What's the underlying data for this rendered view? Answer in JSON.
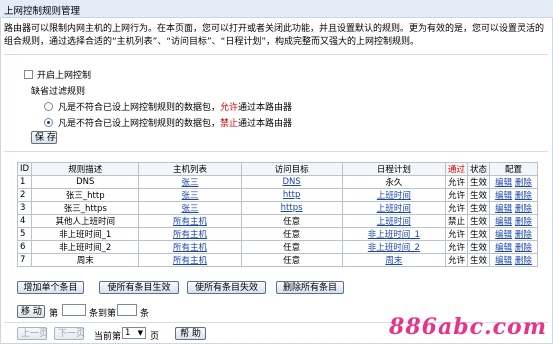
{
  "page": {
    "title": "上网控制规则管理",
    "intro": "路由器可以限制内网主机的上网行为。在本页面，您可以打开或者关闭此功能，并且设置默认的规则。更为有效的是，您可以设置灵活的组合规则，通过选择合适的“主机列表”、“访问目标”、“日程计划”，构成完整而又强大的上网控制规则。"
  },
  "settings": {
    "enable_label": "开启上网控制",
    "default_rule_label": "缺省过滤规则",
    "radio1": {
      "pre": "凡是不符合已设上网控制规则的数据包，",
      "action": "允许",
      "post": "通过本路由器"
    },
    "radio2": {
      "pre": "凡是不符合已设上网控制规则的数据包，",
      "action": "禁止",
      "post": "通过本路由器"
    },
    "save_label": "保 存"
  },
  "table": {
    "headers": [
      "ID",
      "规则描述",
      "主机列表",
      "访问目标",
      "日程计划",
      "通过",
      "状态",
      "配置"
    ],
    "rows": [
      {
        "id": "1",
        "desc": "DNS",
        "host": "张三",
        "target": "DNS",
        "schedule": "永久",
        "pass": "允许",
        "status": "生效",
        "edit": "编辑",
        "del": "删除"
      },
      {
        "id": "2",
        "desc": "张三_http",
        "host": "张三",
        "target": "http",
        "schedule": "上班时间",
        "pass": "允许",
        "status": "生效",
        "edit": "编辑",
        "del": "删除"
      },
      {
        "id": "3",
        "desc": "张三_https",
        "host": "张三",
        "target": "https",
        "schedule": "上班时间",
        "pass": "允许",
        "status": "生效",
        "edit": "编辑",
        "del": "删除"
      },
      {
        "id": "4",
        "desc": "其他人上班时间",
        "host": "所有主机",
        "target": "任意",
        "schedule": "上班时间",
        "pass": "禁止",
        "status": "生效",
        "edit": "编辑",
        "del": "删除"
      },
      {
        "id": "5",
        "desc": "非上班时间_1",
        "host": "所有主机",
        "target": "任意",
        "schedule": "非上班时间_1",
        "pass": "允许",
        "status": "生效",
        "edit": "编辑",
        "del": "删除"
      },
      {
        "id": "6",
        "desc": "非上班时间_2",
        "host": "所有主机",
        "target": "任意",
        "schedule": "非上班时间_2",
        "pass": "允许",
        "status": "生效",
        "edit": "编辑",
        "del": "删除"
      },
      {
        "id": "7",
        "desc": "周末",
        "host": "所有主机",
        "target": "任意",
        "schedule": "周末",
        "pass": "允许",
        "status": "生效",
        "edit": "编辑",
        "del": "删除"
      }
    ]
  },
  "actions": {
    "add": "增加单个条目",
    "enable_all": "使所有条目生效",
    "disable_all": "使所有条目失效",
    "delete_all": "删除所有条目"
  },
  "move": {
    "button": "移 动",
    "di": "第",
    "tiao_dao_di": "条到第",
    "tiao": "条"
  },
  "pager": {
    "prev": "上一页",
    "next": "下一页",
    "current_pre": "当前第",
    "current_page": "1",
    "current_post": "页",
    "help": "帮 助"
  },
  "watermark": "886abc.com"
}
